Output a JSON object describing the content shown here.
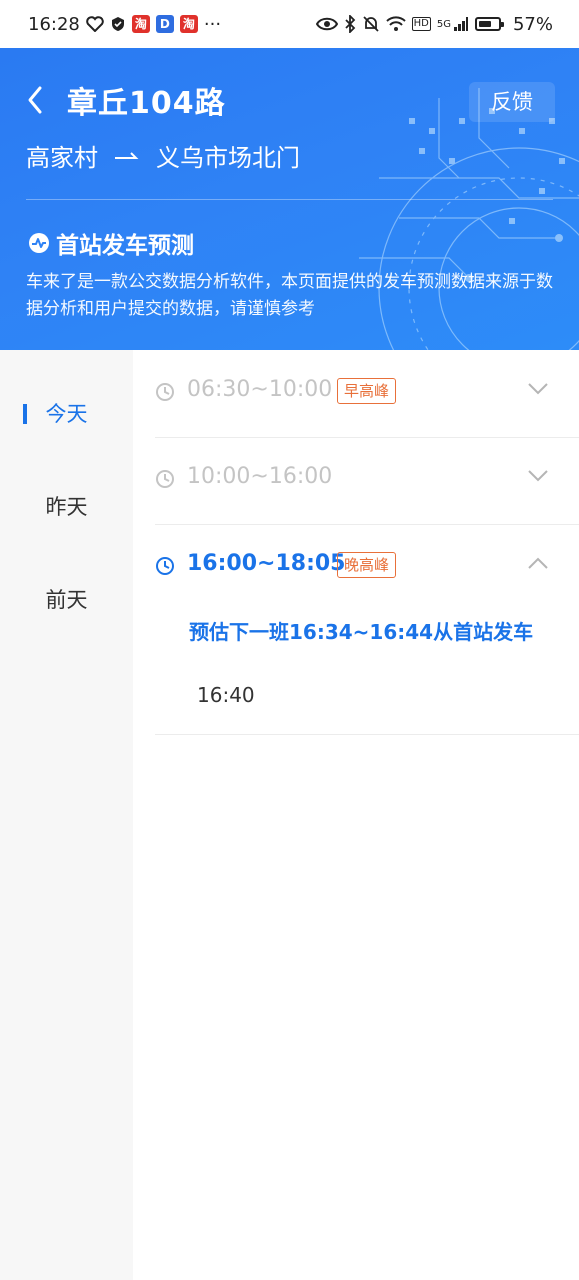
{
  "status_bar": {
    "time": "16:28",
    "app_chip_1": "淘",
    "app_chip_2": "D",
    "app_chip_3": "淘",
    "more": "···",
    "network_hd": "HD",
    "network_gen": "5G",
    "battery": "57%"
  },
  "header": {
    "route_name": "章丘104路",
    "feedback": "反馈",
    "from_stop": "高家村",
    "to_stop": "义乌市场北门",
    "prediction_title": "首站发车预测",
    "prediction_desc": "车来了是一款公交数据分析软件，本页面提供的发车预测数据来源于数据分析和用户提交的数据，请谨慎参考"
  },
  "days": [
    {
      "label": "今天",
      "active": true
    },
    {
      "label": "昨天",
      "active": false
    },
    {
      "label": "前天",
      "active": false
    }
  ],
  "slots": [
    {
      "time": "06:30~10:00",
      "tag": "早高峰",
      "expanded": false
    },
    {
      "time": "10:00~16:00",
      "tag": "",
      "expanded": false
    },
    {
      "time": "16:00~18:05",
      "tag": "晚高峰",
      "expanded": true
    }
  ],
  "expanded_detail": {
    "next_bus": "预估下一班16:34~16:44从首站发车",
    "departures": [
      "16:40"
    ]
  },
  "colors": {
    "accent": "#1a73e8",
    "header_bg": "#2f82f5",
    "peak_tag": "#e8703a",
    "inactive_text": "#c4c4c4"
  }
}
